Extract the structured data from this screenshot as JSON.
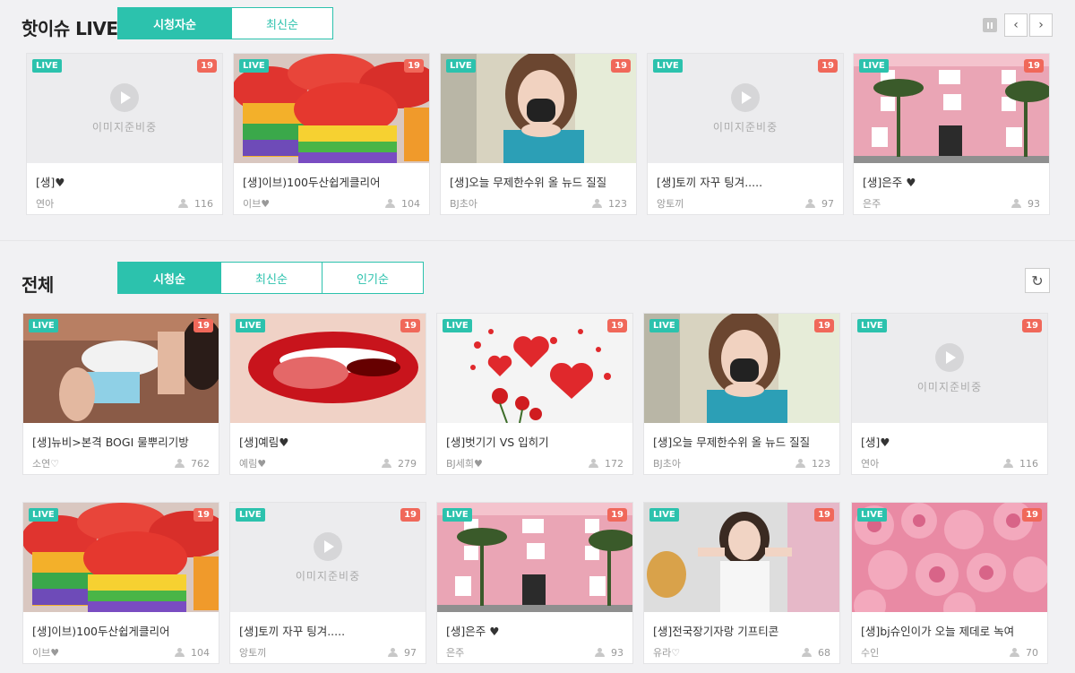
{
  "hot": {
    "title": "핫이슈 LIVE",
    "tabs": [
      "시청자순",
      "최신순"
    ],
    "active_tab": 0
  },
  "all": {
    "title": "전체",
    "tabs": [
      "시청순",
      "최신순",
      "인기순"
    ],
    "active_tab": 0
  },
  "controls": {
    "prev": "‹",
    "next": "›",
    "refresh": "↻"
  },
  "badges": {
    "live": "LIVE",
    "age": "19"
  },
  "placeholder_text": "이미지준비중",
  "colors": {
    "accent": "#2cc2ad",
    "age_badge": "#f0685a",
    "background": "#f1f1f3"
  },
  "hot_cards": [
    {
      "title": "[생]♥",
      "user": "연아",
      "viewers": "116",
      "thumb": "placeholder"
    },
    {
      "title": "[생]이브)100두산쉽게클리어",
      "user": "이브♥",
      "viewers": "104",
      "thumb": "cupcakes"
    },
    {
      "title": "[생]오늘 무제한수위 올 뉴드 질질",
      "user": "BJ초아",
      "viewers": "123",
      "thumb": "girl-mask"
    },
    {
      "title": "[생]토끼 자꾸 팅겨.....",
      "user": "앙토끼",
      "viewers": "97",
      "thumb": "placeholder"
    },
    {
      "title": "[생]은주 ♥",
      "user": "은주",
      "viewers": "93",
      "thumb": "pink-building"
    }
  ],
  "all_cards_row1": [
    {
      "title": "[생]뉴비>본격 BOGI 물뿌리기방",
      "user": "소연♡",
      "viewers": "762",
      "thumb": "pose"
    },
    {
      "title": "[생]예림♥",
      "user": "예림♥",
      "viewers": "279",
      "thumb": "lips"
    },
    {
      "title": "[생]벗기기 VS 입히기",
      "user": "BJ세희♥",
      "viewers": "172",
      "thumb": "hearts"
    },
    {
      "title": "[생]오늘 무제한수위 올 뉴드 질질",
      "user": "BJ초아",
      "viewers": "123",
      "thumb": "girl-mask"
    },
    {
      "title": "[생]♥",
      "user": "연아",
      "viewers": "116",
      "thumb": "placeholder"
    }
  ],
  "all_cards_row2": [
    {
      "title": "[생]이브)100두산쉽게클리어",
      "user": "이브♥",
      "viewers": "104",
      "thumb": "cupcakes"
    },
    {
      "title": "[생]토끼 자꾸 팅겨.....",
      "user": "앙토끼",
      "viewers": "97",
      "thumb": "placeholder"
    },
    {
      "title": "[생]은주 ♥",
      "user": "은주",
      "viewers": "93",
      "thumb": "pink-building"
    },
    {
      "title": "[생]전국장기자랑 기프티콘",
      "user": "유라♡",
      "viewers": "68",
      "thumb": "girl-room"
    },
    {
      "title": "[생]bj슈인이가 오늘 제데로 녹여",
      "user": "수인",
      "viewers": "70",
      "thumb": "roses"
    }
  ]
}
